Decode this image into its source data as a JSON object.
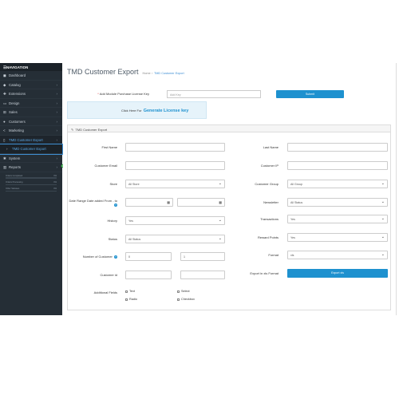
{
  "sidebar": {
    "heading": "NAVIGATION",
    "items": [
      {
        "label": "Dashboard",
        "icon": "dashboard-icon",
        "glyph": "◼",
        "chevron": ""
      },
      {
        "label": "Catalog",
        "icon": "tag-icon",
        "glyph": "◆",
        "chevron": "›"
      },
      {
        "label": "Extensions",
        "icon": "puzzle-icon",
        "glyph": "✚",
        "chevron": "›"
      },
      {
        "label": "Design",
        "icon": "television-icon",
        "glyph": "▭",
        "chevron": "›"
      },
      {
        "label": "Sales",
        "icon": "cart-icon",
        "glyph": "⊞",
        "chevron": "›"
      },
      {
        "label": "Customers",
        "icon": "user-icon",
        "glyph": "●",
        "chevron": "›"
      },
      {
        "label": "Marketing",
        "icon": "share-icon",
        "glyph": "<",
        "chevron": "›"
      },
      {
        "label": "TMD Customer Export",
        "icon": "file-icon",
        "glyph": "▯",
        "chevron": "›"
      },
      {
        "label": "TMD Customer Export",
        "icon": "chevron-right-icon",
        "glyph": "›",
        "chevron": ""
      },
      {
        "label": "System",
        "icon": "gear-icon",
        "glyph": "✱",
        "chevron": "›"
      },
      {
        "label": "Reports",
        "icon": "bar-chart-icon",
        "glyph": "▥",
        "chevron": "›"
      }
    ],
    "progress": [
      {
        "label": "Orders Completed",
        "value": "0%",
        "fraction": 0
      },
      {
        "label": "Orders Processing",
        "value": "0%",
        "fraction": 0
      },
      {
        "label": "Other Statuses",
        "value": "0%",
        "fraction": 0
      }
    ]
  },
  "page": {
    "title": "TMD Customer Export",
    "breadcrumb": [
      "Home",
      "TMD Customer Export"
    ]
  },
  "license": {
    "required_mark": "*",
    "label": "Add Module Purchase License Key",
    "placeholder": "Add Key",
    "submit": "Submit",
    "generate_prefix": "Click Here For",
    "generate_link": "Generate License key"
  },
  "panel": {
    "title": "TMD Customer Export"
  },
  "form": {
    "first_name_label": "First Name",
    "last_name_label": "Last Name",
    "customer_email_label": "Customer Email",
    "customer_ip_label": "Customer IP",
    "store_label": "Store",
    "store_value": "All Store",
    "customer_group_label": "Customer Group",
    "customer_group_value": "All Group",
    "date_range_label": "Date Range Date added From - to",
    "newsletter_label": "Newsletter",
    "newsletter_value": "All Status",
    "history_label": "History",
    "history_value": "Yes",
    "transactions_label": "Transactions",
    "transactions_value": "Yes",
    "status_label": "Status",
    "status_value": "All Status",
    "reward_points_label": "Reward Points",
    "reward_points_value": "Yes",
    "number_of_customer_label": "Number of Customer",
    "number_from": "0",
    "number_to": "1",
    "format_label": "Format",
    "format_value": "xls",
    "customer_id_label": "Customer id",
    "export_in_label": "Export in xls Format",
    "export_button": "Export xls",
    "additional_fields_label": "Additional Fields",
    "checkboxes": [
      "Text",
      "Select",
      "Radio",
      "Checkbox"
    ]
  },
  "colors": {
    "sidebar_bg": "#252e36",
    "accent": "#1e91cf",
    "highlight_arrow": "#3ab54a"
  }
}
